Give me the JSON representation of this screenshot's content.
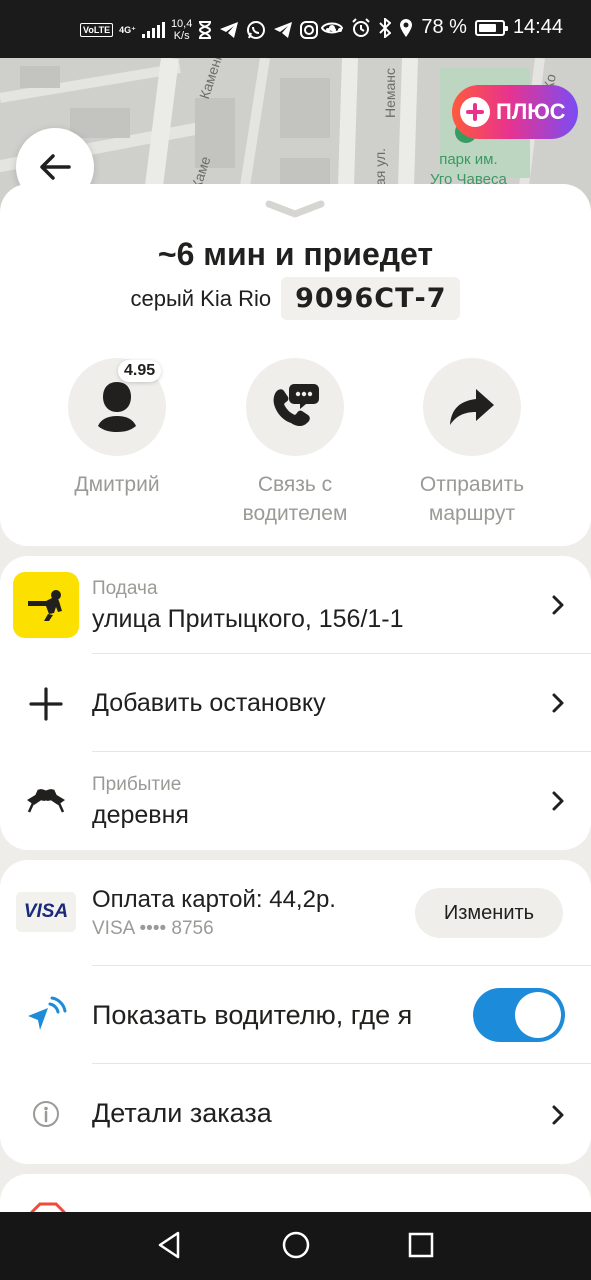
{
  "status_bar": {
    "network": "VoLTE",
    "signal_type": "4G⁺",
    "speed_value": "10,4",
    "speed_unit": "K/s",
    "battery_percent": "78 %",
    "battery_level": 0.78,
    "time": "14:44"
  },
  "map": {
    "streets": [
      "Каменна",
      "Каме",
      "Неманс",
      "ая ул.",
      "Ко"
    ],
    "park_line1": "парк им.",
    "park_line2": "Уго Чавеса",
    "plus_badge_label": "ПЛЮС"
  },
  "order": {
    "eta_title": "~6 мин и приедет",
    "car_model": "серый Kia Rio",
    "plate": "9096СТ-7"
  },
  "actions": {
    "driver_name": "Дмитрий",
    "driver_rating": "4.95",
    "contact_line1": "Связь с",
    "contact_line2": "водителем",
    "share_line1": "Отправить",
    "share_line2": "маршрут"
  },
  "route": {
    "pickup_label": "Подача",
    "pickup_address": "улица Притыцкого, 156/1-1",
    "add_stop_label": "Добавить остановку",
    "arrival_label": "Прибытие",
    "arrival_address": "деревня"
  },
  "payment": {
    "card_brand": "VISA",
    "title": "Оплата картой: 44,2р.",
    "card_number": "VISA •••• 8756",
    "change_button": "Изменить",
    "show_location_label": "Показать водителю, где я",
    "show_location_enabled": true,
    "order_details_label": "Детали заказа"
  },
  "colors": {
    "accent_yellow": "#fce000",
    "toggle_blue": "#1c8bd9",
    "muted_text": "#9b9a96"
  }
}
